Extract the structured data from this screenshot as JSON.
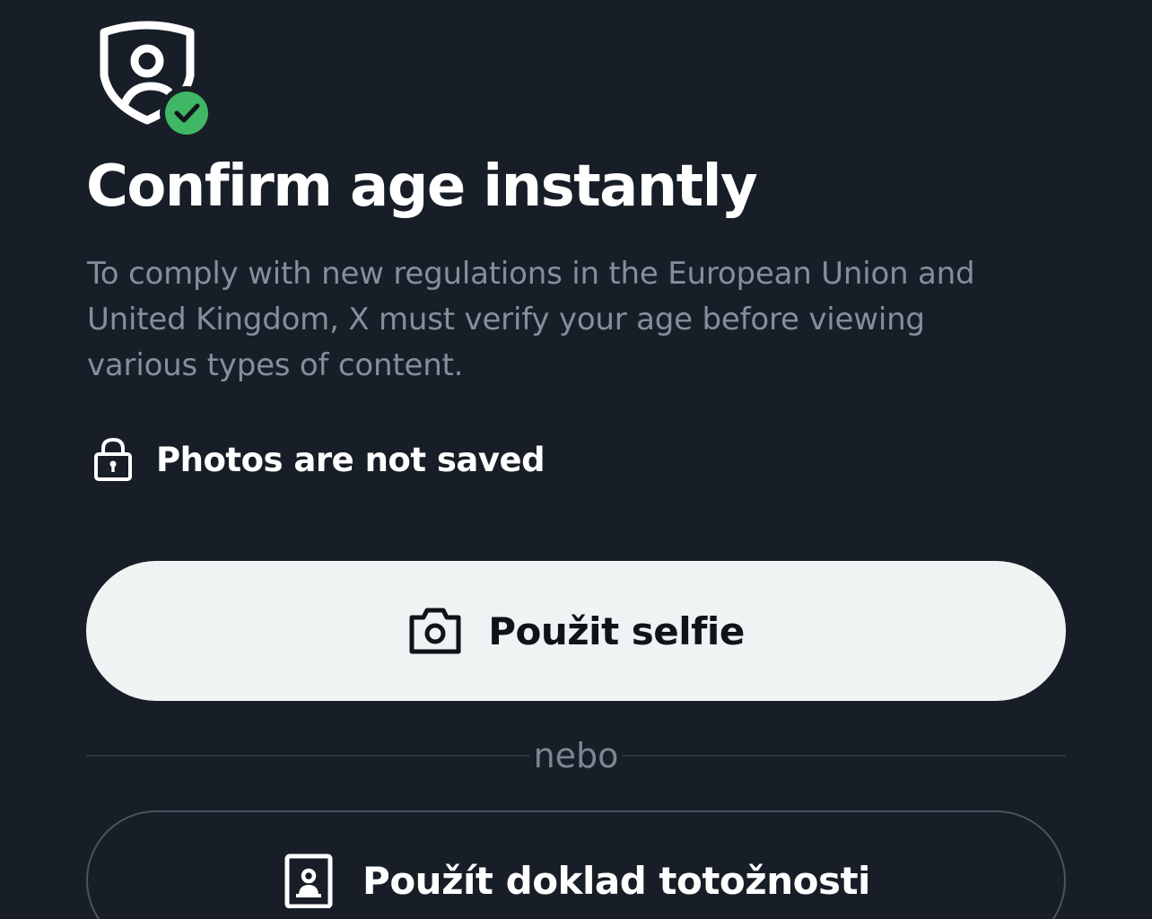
{
  "header": {
    "icon": "shield-person-verified-icon",
    "title": "Confirm age instantly",
    "description": "To comply with new regulations in the European Union and United Kingdom, X must verify your age before viewing various types of content."
  },
  "privacy_note": {
    "icon": "lock-icon",
    "text": "Photos are not saved"
  },
  "actions": {
    "selfie": {
      "icon": "camera-icon",
      "label": "Použit selfie"
    },
    "separator": "nebo",
    "id_document": {
      "icon": "id-card-icon",
      "label": "Použít doklad totožnosti"
    }
  },
  "colors": {
    "background": "#171e27",
    "primary_text": "#ffffff",
    "secondary_text": "#848f9b",
    "primary_button_bg": "#eff3f4",
    "primary_button_text": "#0f1419",
    "secondary_button_border": "#4a545e",
    "verified_badge": "#3fb764"
  }
}
